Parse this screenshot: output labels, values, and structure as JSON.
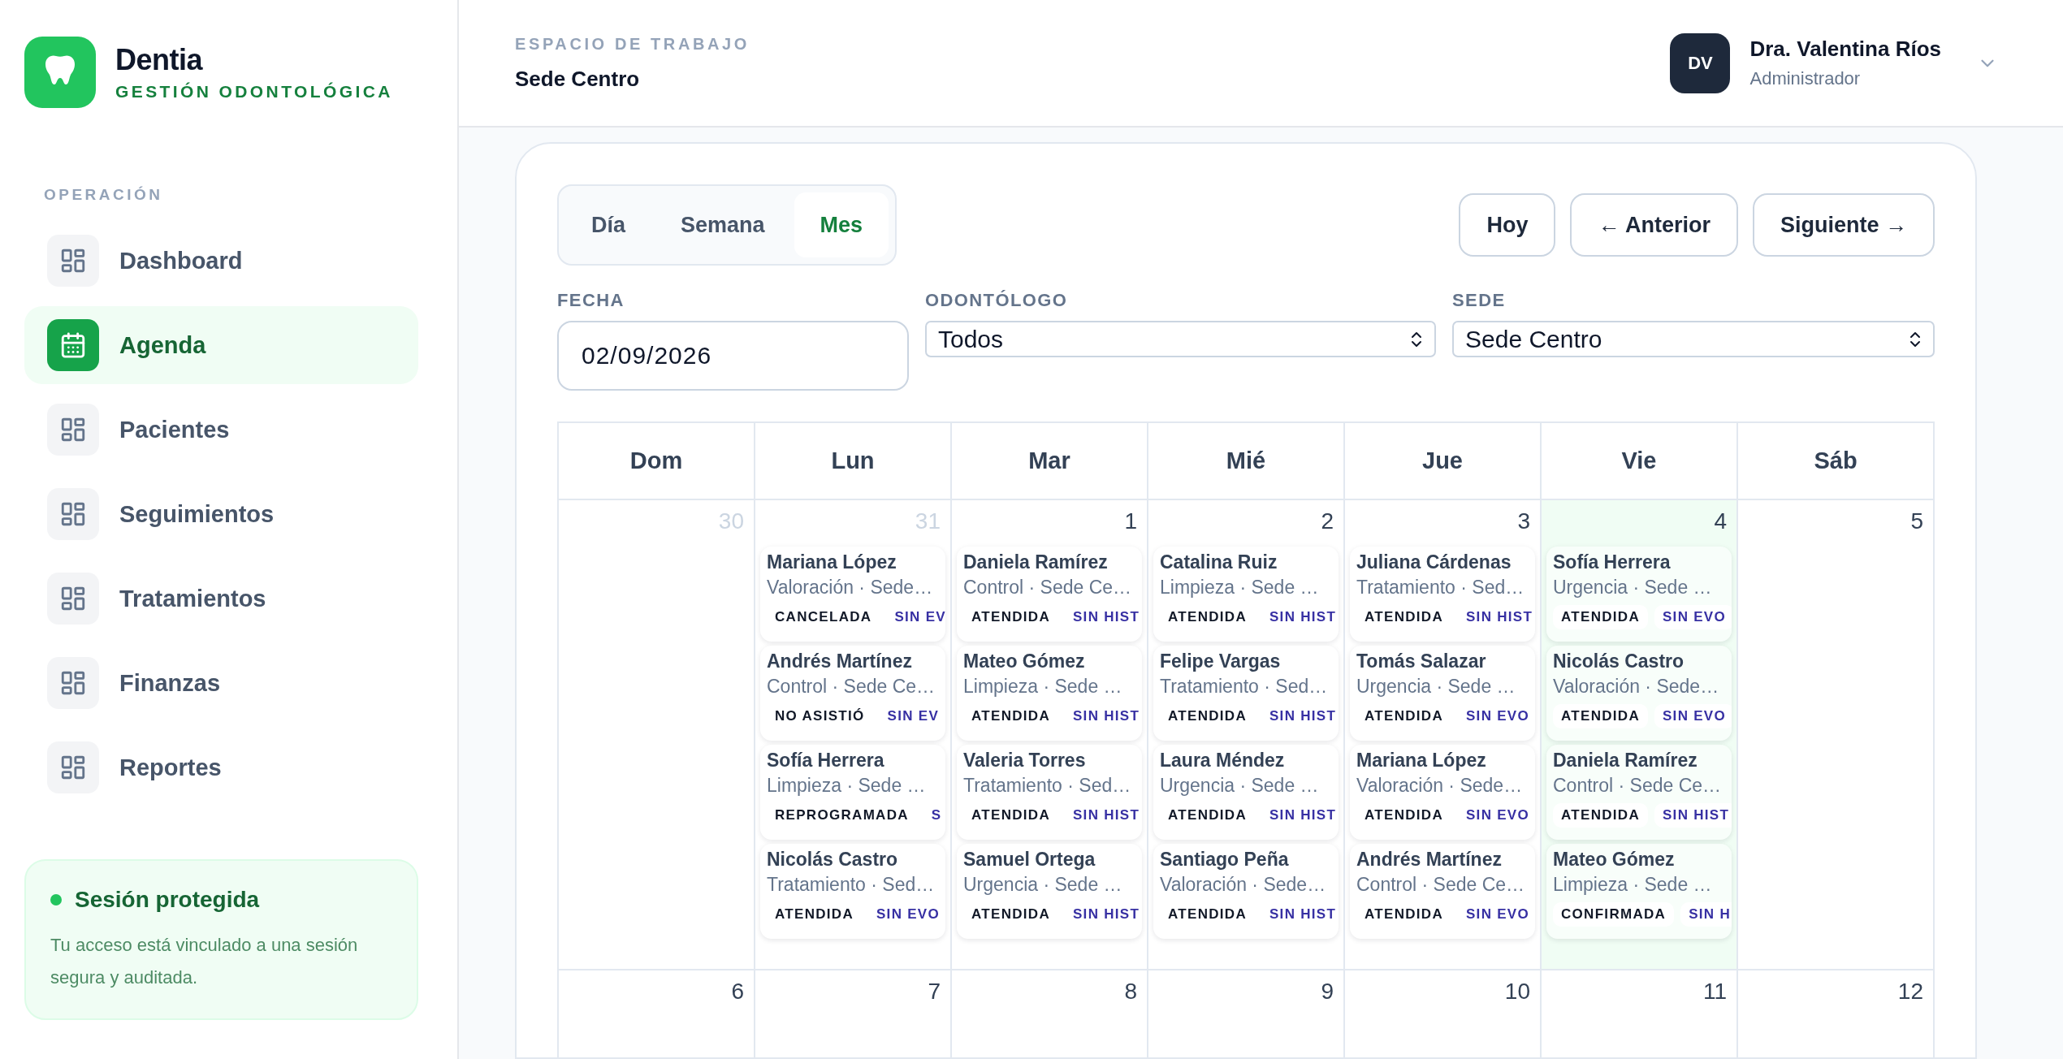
{
  "brand": {
    "name": "Dentia",
    "tagline": "GESTIÓN ODONTOLÓGICA"
  },
  "sidebar": {
    "section": "OPERACIÓN",
    "items": [
      {
        "label": "Dashboard",
        "selected": false
      },
      {
        "label": "Agenda",
        "selected": true
      },
      {
        "label": "Pacientes",
        "selected": false
      },
      {
        "label": "Seguimientos",
        "selected": false
      },
      {
        "label": "Tratamientos",
        "selected": false
      },
      {
        "label": "Finanzas",
        "selected": false
      },
      {
        "label": "Reportes",
        "selected": false
      }
    ],
    "notice": {
      "title": "Sesión protegida",
      "text": "Tu acceso está vinculado a una sesión segura y auditada."
    }
  },
  "header": {
    "eyebrow": "ESPACIO DE TRABAJO",
    "workspace": "Sede Centro",
    "user": {
      "initials": "DV",
      "name": "Dra. Valentina Ríos",
      "role": "Administrador"
    }
  },
  "views": [
    {
      "label": "Día",
      "selected": false
    },
    {
      "label": "Semana",
      "selected": false
    },
    {
      "label": "Mes",
      "selected": true
    }
  ],
  "nav_buttons": [
    "Hoy",
    "← Anterior",
    "Siguiente →"
  ],
  "filters": [
    {
      "kind": "date",
      "label": "FECHA",
      "value": "02/09/2026"
    },
    {
      "kind": "select",
      "label": "ODONTÓLOGO",
      "value": "Todos"
    },
    {
      "kind": "select",
      "label": "SEDE",
      "value": "Sede Centro"
    }
  ],
  "calendar": {
    "weekdays": [
      "Dom",
      "Lun",
      "Mar",
      "Mié",
      "Jue",
      "Vie",
      "Sáb"
    ],
    "weeks": [
      [
        {
          "day": "30",
          "muted": true,
          "today": false
        },
        {
          "day": "31",
          "muted": true,
          "today": false,
          "appointments": [
            {
              "patient": "Mariana López",
              "detail": "Valoración · Sede…",
              "status": "CANCELADA",
              "record": "SIN EV"
            },
            {
              "patient": "Andrés Martínez",
              "detail": "Control · Sede Ce…",
              "status": "NO ASISTIÓ",
              "record": "SIN EV"
            },
            {
              "patient": "Sofía Herrera",
              "detail": "Limpieza · Sede …",
              "status": "REPROGRAMADA",
              "record": "S"
            },
            {
              "patient": "Nicolás Castro",
              "detail": "Tratamiento · Sed…",
              "status": "ATENDIDA",
              "record": "SIN EVO"
            }
          ]
        },
        {
          "day": "1",
          "muted": false,
          "today": false,
          "appointments": [
            {
              "patient": "Daniela Ramírez",
              "detail": "Control · Sede Ce…",
              "status": "ATENDIDA",
              "record": "SIN HIST"
            },
            {
              "patient": "Mateo Gómez",
              "detail": "Limpieza · Sede …",
              "status": "ATENDIDA",
              "record": "SIN HIST"
            },
            {
              "patient": "Valeria Torres",
              "detail": "Tratamiento · Sed…",
              "status": "ATENDIDA",
              "record": "SIN HIST"
            },
            {
              "patient": "Samuel Ortega",
              "detail": "Urgencia · Sede …",
              "status": "ATENDIDA",
              "record": "SIN HIST"
            }
          ]
        },
        {
          "day": "2",
          "muted": false,
          "today": false,
          "appointments": [
            {
              "patient": "Catalina Ruiz",
              "detail": "Limpieza · Sede …",
              "status": "ATENDIDA",
              "record": "SIN HIST"
            },
            {
              "patient": "Felipe Vargas",
              "detail": "Tratamiento · Sed…",
              "status": "ATENDIDA",
              "record": "SIN HIST"
            },
            {
              "patient": "Laura Méndez",
              "detail": "Urgencia · Sede …",
              "status": "ATENDIDA",
              "record": "SIN HIST"
            },
            {
              "patient": "Santiago Peña",
              "detail": "Valoración · Sede…",
              "status": "ATENDIDA",
              "record": "SIN HIST"
            }
          ]
        },
        {
          "day": "3",
          "muted": false,
          "today": false,
          "appointments": [
            {
              "patient": "Juliana Cárdenas",
              "detail": "Tratamiento · Sed…",
              "status": "ATENDIDA",
              "record": "SIN HIST"
            },
            {
              "patient": "Tomás Salazar",
              "detail": "Urgencia · Sede …",
              "status": "ATENDIDA",
              "record": "SIN EVO"
            },
            {
              "patient": "Mariana López",
              "detail": "Valoración · Sede…",
              "status": "ATENDIDA",
              "record": "SIN EVO"
            },
            {
              "patient": "Andrés Martínez",
              "detail": "Control · Sede Ce…",
              "status": "ATENDIDA",
              "record": "SIN EVO"
            }
          ]
        },
        {
          "day": "4",
          "muted": false,
          "today": true,
          "appointments": [
            {
              "patient": "Sofía Herrera",
              "detail": "Urgencia · Sede …",
              "status": "ATENDIDA",
              "record": "SIN EVO"
            },
            {
              "patient": "Nicolás Castro",
              "detail": "Valoración · Sede…",
              "status": "ATENDIDA",
              "record": "SIN EVO"
            },
            {
              "patient": "Daniela Ramírez",
              "detail": "Control · Sede Ce…",
              "status": "ATENDIDA",
              "record": "SIN HIST"
            },
            {
              "patient": "Mateo Gómez",
              "detail": "Limpieza · Sede …",
              "status": "CONFIRMADA",
              "record": "SIN H"
            }
          ]
        },
        {
          "day": "5",
          "muted": false,
          "today": false
        }
      ],
      [
        {
          "day": "6",
          "muted": false,
          "today": false
        },
        {
          "day": "7",
          "muted": false,
          "today": false
        },
        {
          "day": "8",
          "muted": false,
          "today": false
        },
        {
          "day": "9",
          "muted": false,
          "today": false
        },
        {
          "day": "10",
          "muted": false,
          "today": false
        },
        {
          "day": "11",
          "muted": false,
          "today": false
        },
        {
          "day": "12",
          "muted": false,
          "today": false
        }
      ]
    ]
  }
}
